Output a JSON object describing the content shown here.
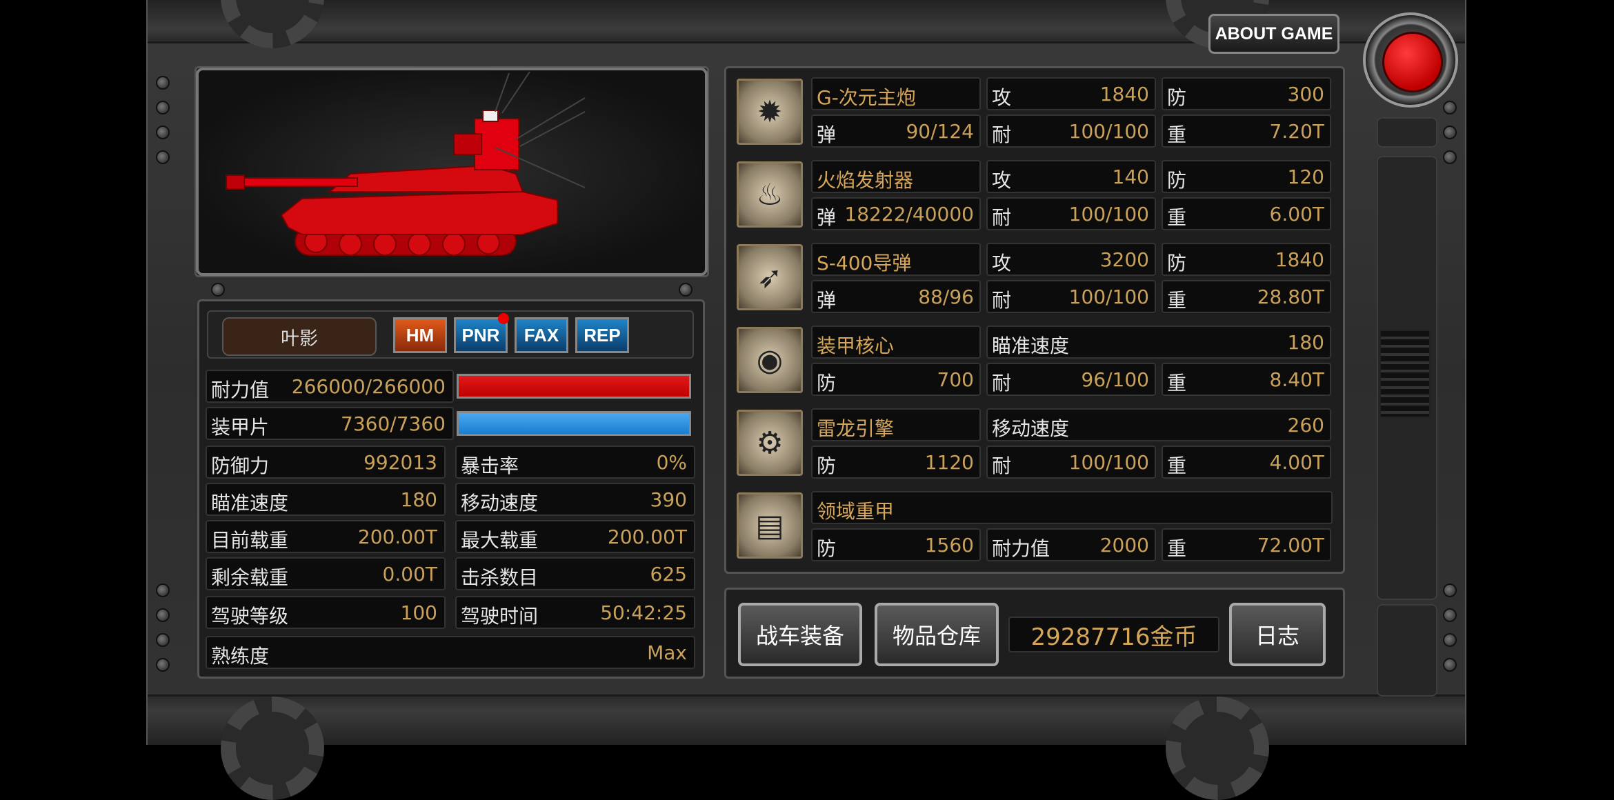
{
  "header": {
    "about_label": "ABOUT GAME"
  },
  "tank": {
    "name": "叶影",
    "chips": [
      "HM",
      "PNR",
      "FAX",
      "REP"
    ],
    "durability": {
      "label": "耐力值",
      "value": "266000/266000",
      "fraction": 1.0,
      "color": "#c00000"
    },
    "armor": {
      "label": "装甲片",
      "value": "7360/7360",
      "fraction": 1.0,
      "color": "#1a7fd0"
    },
    "stats": [
      {
        "label": "防御力",
        "value": "992013"
      },
      {
        "label": "暴击率",
        "value": "0%"
      },
      {
        "label": "瞄准速度",
        "value": "180"
      },
      {
        "label": "移动速度",
        "value": "390"
      },
      {
        "label": "目前载重",
        "value": "200.00T"
      },
      {
        "label": "最大载重",
        "value": "200.00T"
      },
      {
        "label": "剩余载重",
        "value": "0.00T"
      },
      {
        "label": "击杀数目",
        "value": "625"
      },
      {
        "label": "驾驶等级",
        "value": "100"
      },
      {
        "label": "驾驶时间",
        "value": "50:42:25"
      }
    ],
    "proficiency": {
      "label": "熟练度",
      "value": "Max"
    }
  },
  "equipment": [
    {
      "name": "G-次元主炮",
      "icon": "cannon-icon",
      "row1": [
        [
          "攻",
          "1840"
        ],
        [
          "防",
          "300"
        ]
      ],
      "row2": [
        [
          "弹",
          "90/124"
        ],
        [
          "耐",
          "100/100"
        ],
        [
          "重",
          "7.20T"
        ]
      ]
    },
    {
      "name": "火焰发射器",
      "icon": "flamethrower-icon",
      "row1": [
        [
          "攻",
          "140"
        ],
        [
          "防",
          "120"
        ]
      ],
      "row2": [
        [
          "弹",
          "18222/40000"
        ],
        [
          "耐",
          "100/100"
        ],
        [
          "重",
          "6.00T"
        ]
      ]
    },
    {
      "name": "S-400导弹",
      "icon": "missile-icon",
      "row1": [
        [
          "攻",
          "3200"
        ],
        [
          "防",
          "1840"
        ]
      ],
      "row2": [
        [
          "弹",
          "88/96"
        ],
        [
          "耐",
          "100/100"
        ],
        [
          "重",
          "28.80T"
        ]
      ]
    },
    {
      "name": "装甲核心",
      "icon": "core-icon",
      "row1": [
        [
          "瞄准速度",
          "180"
        ]
      ],
      "row2": [
        [
          "防",
          "700"
        ],
        [
          "耐",
          "96/100"
        ],
        [
          "重",
          "8.40T"
        ]
      ]
    },
    {
      "name": "雷龙引擎",
      "icon": "engine-icon",
      "row1": [
        [
          "移动速度",
          "260"
        ]
      ],
      "row2": [
        [
          "防",
          "1120"
        ],
        [
          "耐",
          "100/100"
        ],
        [
          "重",
          "4.00T"
        ]
      ]
    },
    {
      "name": "领域重甲",
      "icon": "heavy-armor-icon",
      "row1": [],
      "row2": [
        [
          "防",
          "1560"
        ],
        [
          "耐力值",
          "2000"
        ],
        [
          "重",
          "72.00T"
        ]
      ]
    }
  ],
  "footer": {
    "equip_label": "战车装备",
    "storage_label": "物品仓库",
    "gold": "29287716金币",
    "log_label": "日志"
  }
}
